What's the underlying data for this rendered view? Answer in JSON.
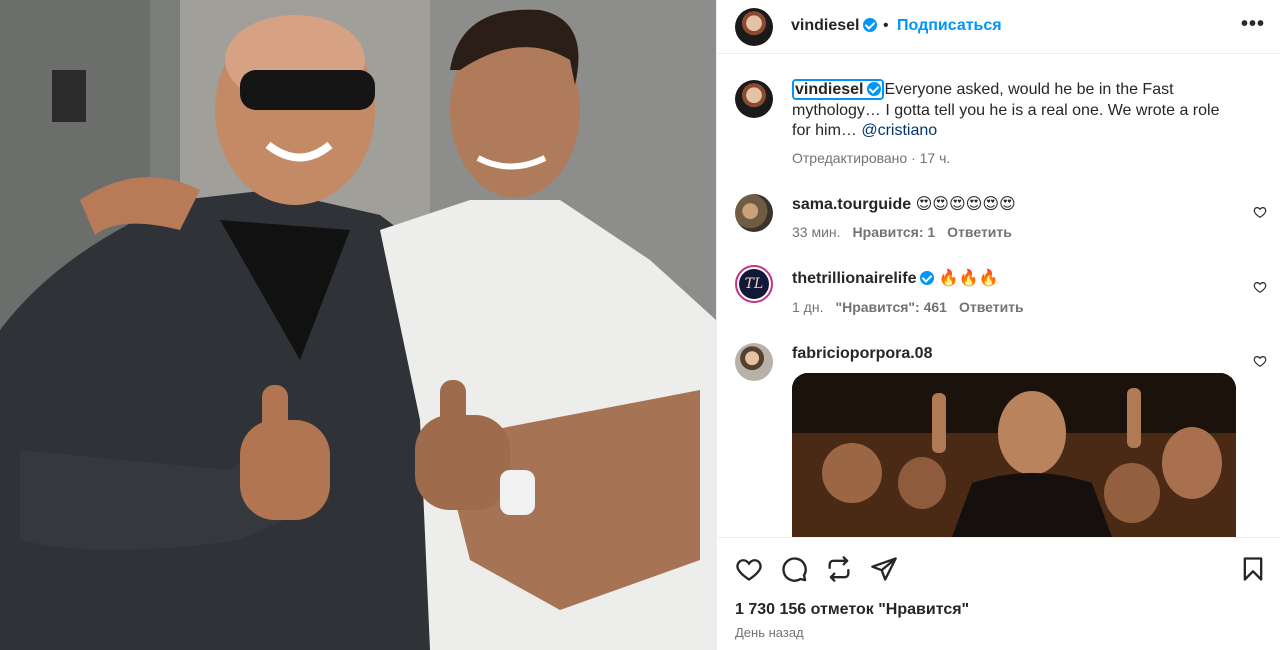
{
  "post_owner": {
    "username": "vindiesel",
    "verified": true,
    "separator": "•",
    "follow_label": "Подписаться",
    "more_label": "•••"
  },
  "caption": {
    "username": "vindiesel",
    "text": "Everyone asked, would he be in the Fast mythology… I gotta tell you he is a real one. We wrote a role for him…",
    "mention": "@cristiano",
    "meta": "Отредактировано · 17 ч."
  },
  "comments": [
    {
      "username": "sama.tourguide",
      "verified": false,
      "text": "😍😍😍😍😍😍",
      "time": "33 мин.",
      "likes": "Нравится: 1",
      "reply": "Ответить",
      "avatar_icon": "sama-avatar"
    },
    {
      "username": "thetrillionairelife",
      "verified": true,
      "text": "🔥🔥🔥",
      "time": "1 дн.",
      "likes": "\"Нравится\": 461",
      "reply": "Ответить",
      "avatar_icon": "trillionaire-avatar",
      "avatar_text": "TL"
    },
    {
      "username": "fabricioporpora.08",
      "verified": false,
      "attachment": "gif",
      "avatar_icon": "fabricio-avatar"
    }
  ],
  "actions": {
    "icons": [
      "heart-icon",
      "comment-icon",
      "repost-icon",
      "share-icon",
      "bookmark-icon"
    ]
  },
  "likes_count": "1 730 156 отметок \"Нравится\"",
  "post_date": "День назад",
  "colors": {
    "accent": "#0095f6",
    "text": "#262626",
    "secondary": "#737373",
    "border": "#efefef"
  }
}
